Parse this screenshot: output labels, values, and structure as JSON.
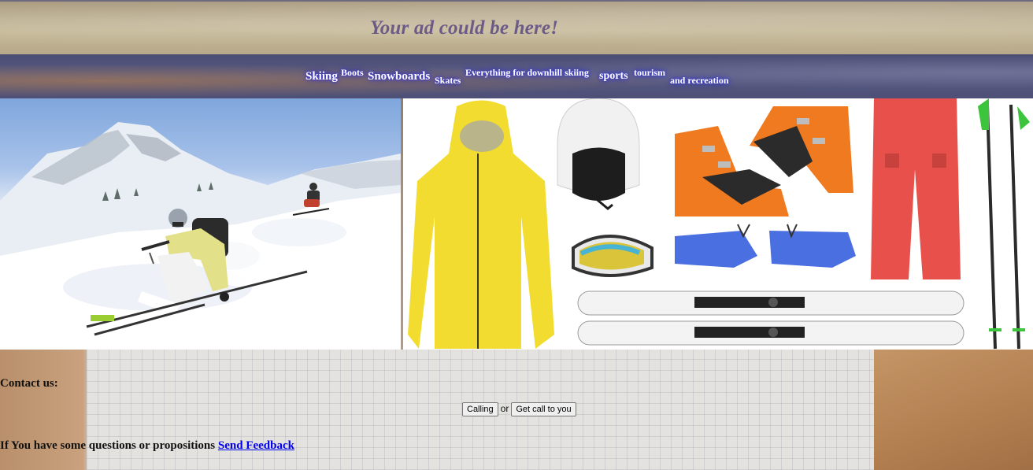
{
  "ad": {
    "text": "Your ad could be here!"
  },
  "nav": {
    "items": [
      {
        "label": "Skiing"
      },
      {
        "label": "Boots"
      },
      {
        "label": "Snowboards"
      },
      {
        "label": "Skates"
      },
      {
        "label": "Everything for downhill skiing"
      },
      {
        "label": "sports"
      },
      {
        "label": "tourism"
      },
      {
        "label": "and recreation"
      }
    ]
  },
  "contact": {
    "label": "Contact us:",
    "call_button": "Calling",
    "or_text": "or",
    "callback_button": "Get call to you",
    "questions_text": "If You have some questions or propositions",
    "feedback_link": "Send Feedback"
  },
  "colors": {
    "ad_text": "#6d5b87",
    "nav_bg": "#4f5179",
    "nav_glow": "#2a2aff",
    "link": "#0000ee",
    "jacket": "#f2dc2f",
    "boots": "#f07a1f",
    "gloves": "#4a6fe0",
    "pants": "#e8514b",
    "poles_accent": "#3cc43c"
  }
}
